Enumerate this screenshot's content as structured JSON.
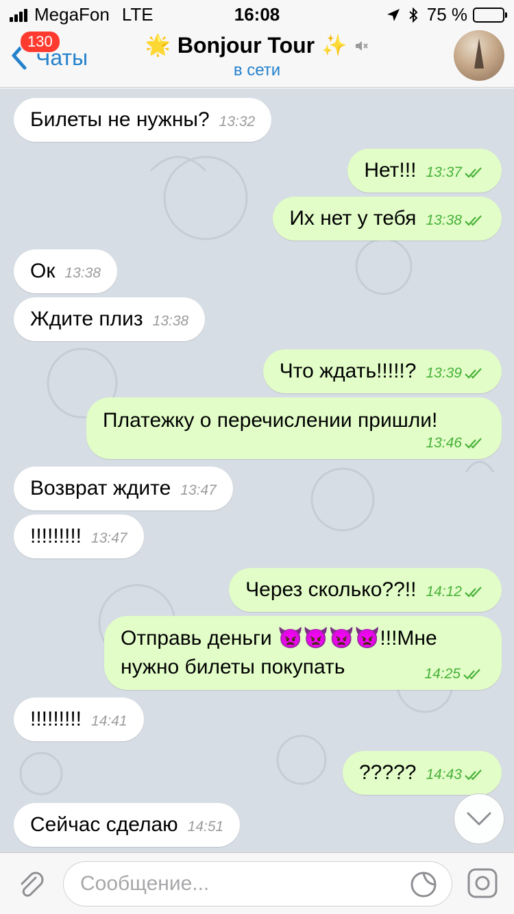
{
  "status_bar": {
    "carrier": "MegaFon",
    "network": "LTE",
    "time": "16:08",
    "battery": "75 %",
    "battery_level": 0.75
  },
  "header": {
    "back_label": "Чаты",
    "unread_badge": "130",
    "title": "Bonjour Tour",
    "title_prefix_emoji": "🌟",
    "title_suffix_emoji": "✨",
    "subtitle": "в сети",
    "accent_color": "#2481cc"
  },
  "messages": [
    {
      "dir": "in",
      "text": "Билеты не нужны?",
      "time": "13:32"
    },
    {
      "dir": "out",
      "text": "Нет!!!",
      "time": "13:37",
      "read": true
    },
    {
      "dir": "out",
      "text": "Их нет у тебя",
      "time": "13:38",
      "read": true
    },
    {
      "dir": "in",
      "text": "Ок",
      "time": "13:38"
    },
    {
      "dir": "in",
      "text": "Ждите плиз",
      "time": "13:38"
    },
    {
      "dir": "out",
      "text": "Что ждать!!!!!?",
      "time": "13:39",
      "read": true
    },
    {
      "dir": "out",
      "text": "Платежку о перечислении пришли!",
      "time": "13:46",
      "read": true
    },
    {
      "dir": "in",
      "text": "Возврат ждите",
      "time": "13:47"
    },
    {
      "dir": "in",
      "text": "!!!!!!!!!",
      "time": "13:47"
    },
    {
      "dir": "out",
      "text": "Через сколько??!!",
      "time": "14:12",
      "read": true
    },
    {
      "dir": "out",
      "text": "Отправь деньги 👿👿👿👿!!!Мне нужно билеты покупать",
      "time": "14:25",
      "read": true
    },
    {
      "dir": "in",
      "text": "!!!!!!!!!",
      "time": "14:41"
    },
    {
      "dir": "out",
      "text": "?????",
      "time": "14:43",
      "read": true
    },
    {
      "dir": "in",
      "text": "Сейчас сделаю",
      "time": "14:51"
    }
  ],
  "composer": {
    "placeholder": "Сообщение..."
  },
  "colors": {
    "incoming_bubble": "#ffffff",
    "outgoing_bubble": "#e2fdc8",
    "read_check": "#47b138",
    "chat_background": "#d7dde4"
  }
}
